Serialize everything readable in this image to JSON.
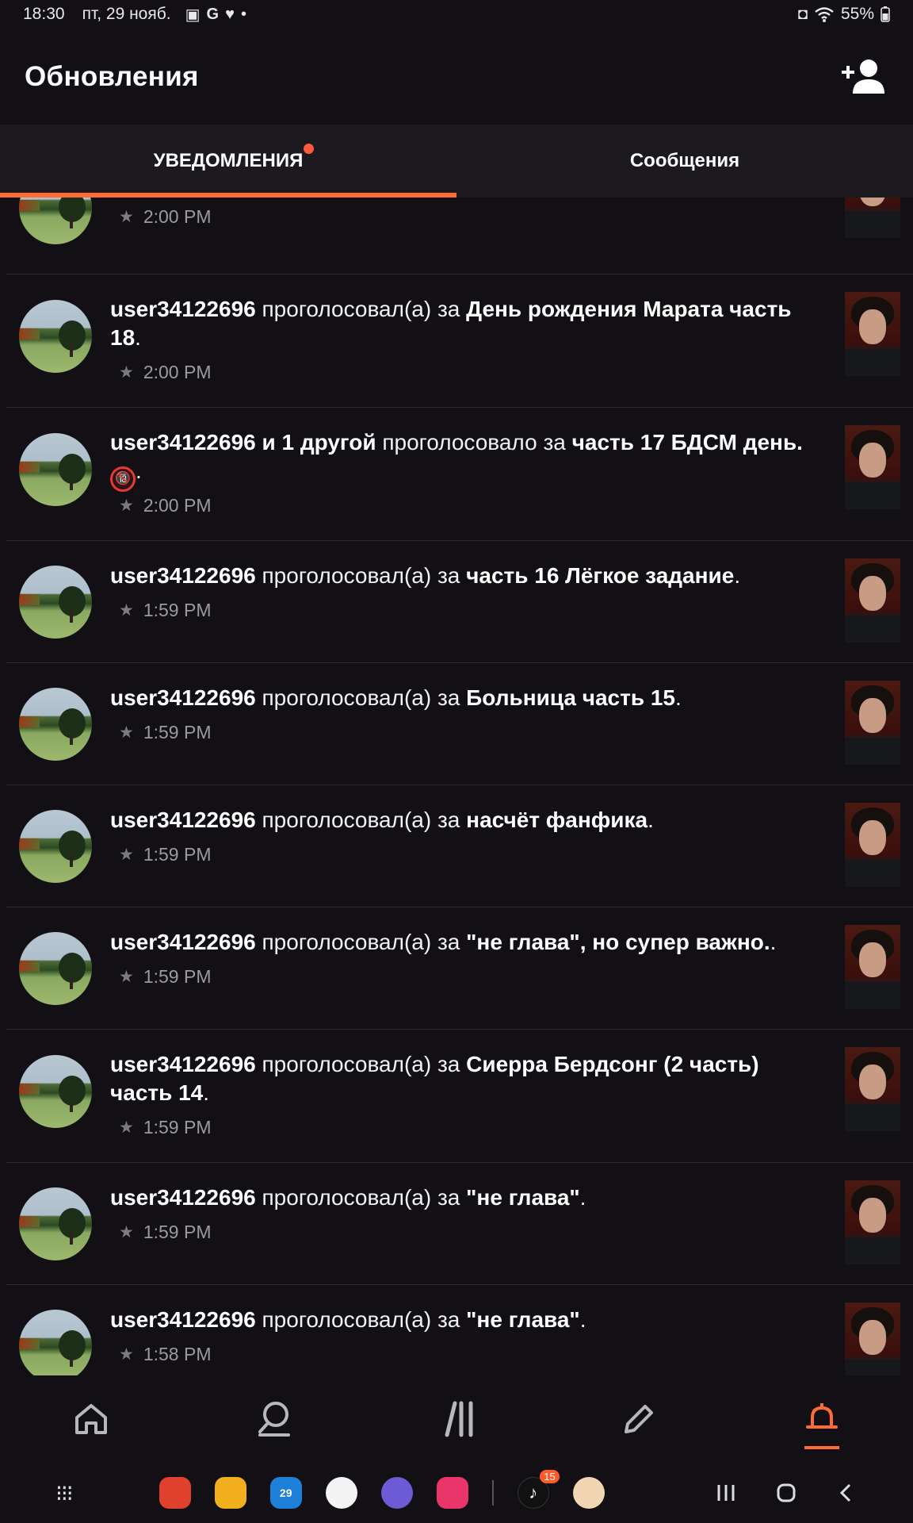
{
  "status_bar": {
    "time": "18:30",
    "date": "пт, 29 нояб.",
    "battery": "55%"
  },
  "header": {
    "title": "Обновления"
  },
  "tabs": [
    {
      "label": "УВЕДОМЛЕНИЯ",
      "active": true,
      "has_dot": true
    },
    {
      "label": "Сообщения",
      "active": false
    }
  ],
  "notifications": [
    {
      "user": "",
      "verb": "",
      "target": "",
      "time": "2:00 PM"
    },
    {
      "user": "user34122696",
      "verb": "проголосовал(а) за",
      "target": "День рождения Марата часть 18",
      "end": ".",
      "time": "2:00 PM"
    },
    {
      "user": "user34122696 и 1 другой",
      "verb": "проголосовало за",
      "target": "часть 17 БДСМ день.",
      "emoji": "🔞",
      "end": ".",
      "time": "2:00 PM"
    },
    {
      "user": "user34122696",
      "verb": "проголосовал(а) за",
      "target": "часть 16 Лёгкое задание",
      "end": ".",
      "time": "1:59 PM"
    },
    {
      "user": "user34122696",
      "verb": "проголосовал(а) за",
      "target": "Больница часть 15",
      "end": ".",
      "time": "1:59 PM"
    },
    {
      "user": "user34122696",
      "verb": "проголосовал(а) за",
      "target": "насчёт фанфика",
      "end": ".",
      "time": "1:59 PM"
    },
    {
      "user": "user34122696",
      "verb": "проголосовал(а) за",
      "target": "\"не глава\", но супер важно.",
      "end": ".",
      "time": "1:59 PM"
    },
    {
      "user": "user34122696",
      "verb": "проголосовал(а) за",
      "target": "Сиерра Бердсонг (2 часть) часть 14",
      "end": ".",
      "time": "1:59 PM"
    },
    {
      "user": "user34122696",
      "verb": "проголосовал(а) за",
      "target": "\"не глава\"",
      "end": ".",
      "time": "1:59 PM"
    },
    {
      "user": "user34122696",
      "verb": "проголосовал(а) за",
      "target": "\"не глава\"",
      "end": ".",
      "time": "1:58 PM"
    }
  ],
  "taskbar": {
    "tiktok_badge": "15",
    "calendar_day": "29"
  },
  "colors": {
    "accent": "#ff6b33",
    "background": "#121014",
    "tab_bar": "#1c1a1e"
  }
}
